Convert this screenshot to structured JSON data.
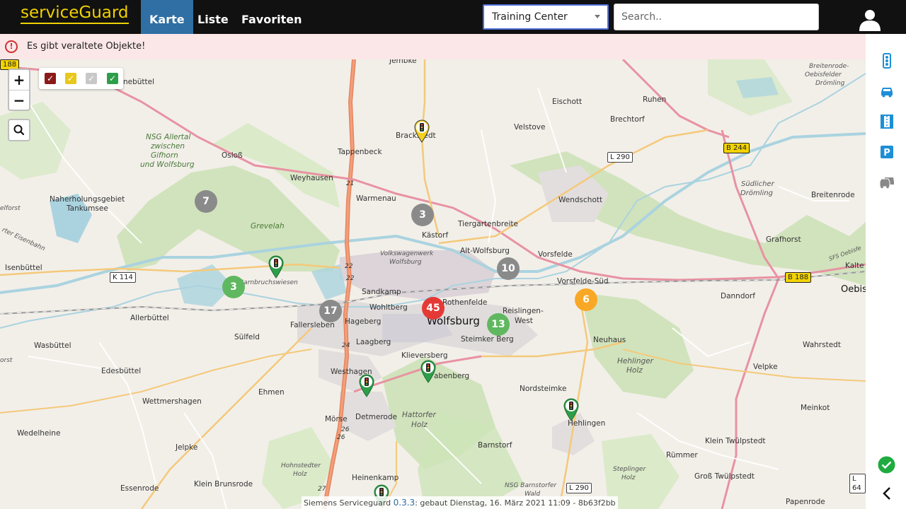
{
  "app": {
    "brand": "serviceGuard"
  },
  "nav": {
    "tabs": [
      {
        "label": "Karte",
        "active": true
      },
      {
        "label": "Liste"
      },
      {
        "label": "Favoriten"
      }
    ]
  },
  "site_select": {
    "value": "Training Center"
  },
  "search": {
    "placeholder": "Search.."
  },
  "warning": {
    "text": "Es gibt veraltete Objekte!",
    "icon": "alert-circle-icon",
    "color": "#d32f2f"
  },
  "sidebar": {
    "icons": [
      "traffic-light-icon",
      "car-icon",
      "parking-garage-icon",
      "parking-icon",
      "vehicles-icon"
    ],
    "status_icon": "check-circle-icon",
    "collapse_icon": "chevron-left-icon"
  },
  "map": {
    "zoom_in": "+",
    "zoom_out": "−",
    "filters": [
      {
        "color": "#8b1a1a",
        "checked": true
      },
      {
        "color": "#e8c81a",
        "checked": true
      },
      {
        "color": "#c8c8c8",
        "checked": true
      },
      {
        "color": "#2e9e4a",
        "checked": true
      }
    ],
    "clusters": [
      {
        "count": "7",
        "color": "#8a8a8a"
      },
      {
        "count": "3",
        "color": "#8a8a8a"
      },
      {
        "count": "10",
        "color": "#8a8a8a"
      },
      {
        "count": "3",
        "color": "#5fb85f"
      },
      {
        "count": "17",
        "color": "#8a8a8a"
      },
      {
        "count": "45",
        "color": "#e53935"
      },
      {
        "count": "13",
        "color": "#5fb85f"
      },
      {
        "count": "6",
        "color": "#f9a825"
      }
    ],
    "places": {
      "jembke": "Jembke",
      "eischott": "Eischott",
      "ruhen": "Ruhen",
      "breitenrode_oebis": "Breitenrode-",
      "oebisfelder": "Oebisfelder",
      "droemling": "Drömling",
      "nebuettel": "nebüttel",
      "velstove": "Velstove",
      "brechtorf": "Brechtorf",
      "brackstedt": "Brackstedt",
      "nsg_allertal1": "NSG Allertal",
      "nsg_allertal2": "zwischen",
      "nsg_allertal3": "Gifhorn",
      "nsg_allertal4": "und Wolfsburg",
      "osloss": "Osloß",
      "tappenbeck": "Tappenbeck",
      "weyhausen": "Weyhausen",
      "warmenau": "Warmenau",
      "wendschott": "Wendschott",
      "suedlicher1": "Südlicher",
      "suedlicher2": "Drömling",
      "breitenrode": "Breitenrode",
      "naherholung1": "Naherholungsgebiet",
      "naherholung2": "Tankumsee",
      "kaestorf": "Kästorf",
      "tiergartenbreite": "Tiergartenbreite",
      "grevelah": "Grevelah",
      "vw1": "Volkswagenwerk",
      "vw2": "Wolfsburg",
      "altwolfsburg": "Alt-Wolfsburg",
      "vorsfelde": "Vorsfelde",
      "grafhorst": "Grafhorst",
      "isenbuettel": "Isenbüttel",
      "barnbruch": "Barnbruchswiesen",
      "sandkamp": "Sandkamp",
      "vorsfeldesued": "Vorsfelde-Süd",
      "danndorf": "Danndorf",
      "oebis": "Oebis",
      "kalte": "Kalte",
      "rothenfelde": "Rothenfelde",
      "wohltberg": "Wohltberg",
      "reislingen1": "Reislingen-",
      "reislingen2": "West",
      "allerbuettel": "Allerbüttel",
      "fallersleben": "Fallersleben",
      "hageberg": "Hageberg",
      "wolfsburg": "Wolfsburg",
      "suelfeld": "Sülfeld",
      "steimker": "Steimker Berg",
      "neuhaus": "Neuhaus",
      "laagberg": "Laagberg",
      "wasbuettel": "Wasbüttel",
      "kleversberg": "Klieversberg",
      "hehlinger1": "Hehlinger",
      "hehlinger2": "Holz",
      "wahrstedt": "Wahrstedt",
      "edesbuettel": "Edesbüttel",
      "westhagen": "Westhagen",
      "fabenberg": "abenberg",
      "velpke": "Velpke",
      "ehmen": "Ehmen",
      "nordsteimke": "Nordsteimke",
      "wettmershagen": "Wettmershagen",
      "hattorfer1": "Hattorfer",
      "hattorfer2": "Holz",
      "meinkot": "Meinkot",
      "moerse": "Mörse",
      "detmerode": "Detmerode",
      "hehlingen": "Hehlingen",
      "wedelheine": "Wedelheine",
      "barnstorf": "Barnstorf",
      "klein_twuelpstedt": "Klein Twülpstedt",
      "jelpke": "Jelpke",
      "hohnstedter1": "Hohnstedter",
      "hohnstedter2": "Holz",
      "rummer": "Rümmer",
      "steplinger1": "Steplinger",
      "steplinger2": "Holz",
      "essenrode": "Essenrode",
      "klein_brunsrode": "Klein Brunsrode",
      "heinenkamp": "Heinenkamp",
      "nsg_barnstorfer1": "NSG Barnstorfer",
      "nsg_barnstorfer2": "Wald",
      "gross_twuelpstedt": "Groß Twülpstedt",
      "papenrode": "Papenrode",
      "elforst": "elforst",
      "orst": "orst",
      "ortersenbahn": "rter Eisenbahn",
      "sfs": "SFS Oebisfe"
    },
    "road_signs": {
      "b188_left": "188",
      "l290_top": "L 290",
      "b244": "B 244",
      "k114": "K 114",
      "b188_right": "B 188",
      "l290_bottom": "L 290",
      "l64": "L 64"
    },
    "motorway_numbers": [
      "21",
      "22",
      "22",
      "24",
      "26",
      "26",
      "27"
    ]
  },
  "footer": {
    "prefix": "Siemens Serviceguard ",
    "version": "0.3.3",
    "suffix": ": gebaut Dienstag, 16. März 2021 11:09 - 8b63f2bb"
  }
}
